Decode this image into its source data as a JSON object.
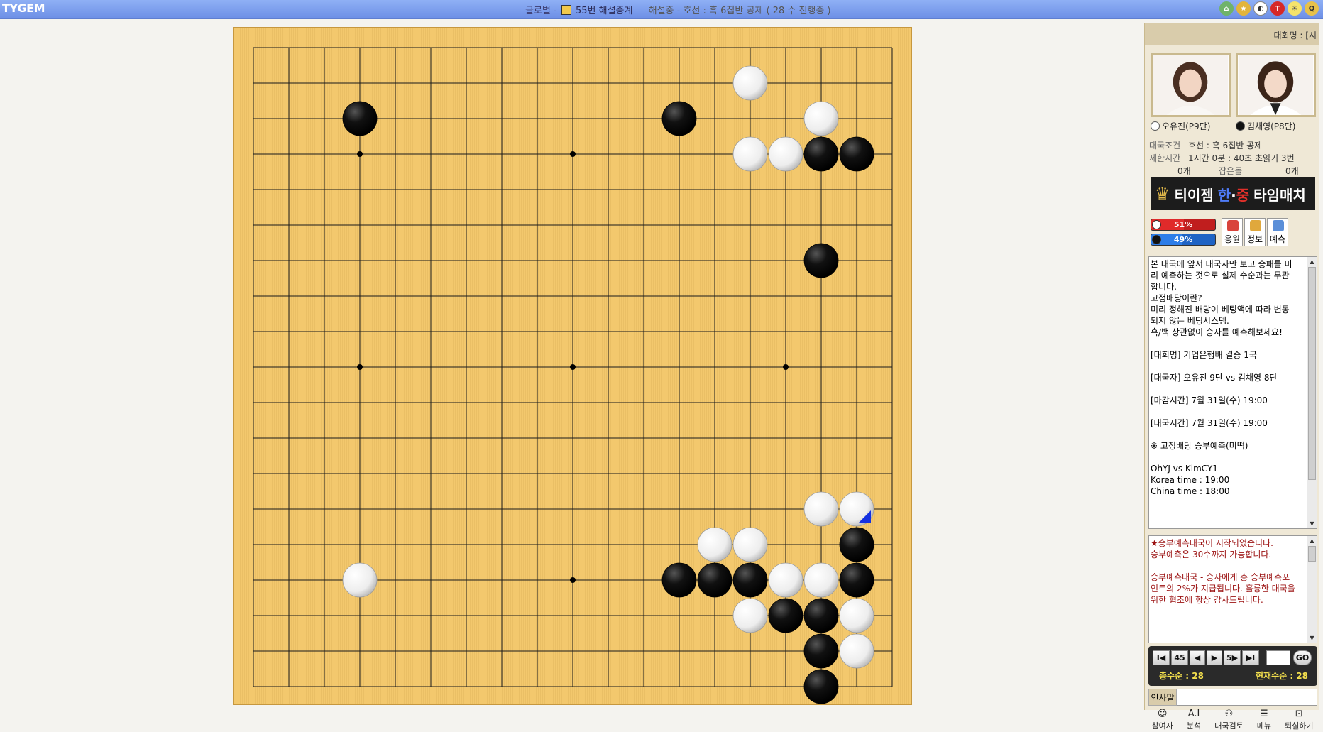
{
  "app": {
    "logo": "TYGEM"
  },
  "titlebar": {
    "prefix": "글로벌 -",
    "room": "55번 해설중계",
    "status": "해설중 - 호선 : 흑 6집반 공제 ( 28 수 진행중 )"
  },
  "top_icons": [
    "home-icon",
    "rank-icon",
    "penguin-icon",
    "t-icon",
    "bulb-icon",
    "quiz-icon"
  ],
  "board": {
    "size": 19,
    "hoshi": [
      [
        3,
        3
      ],
      [
        9,
        3
      ],
      [
        15,
        3
      ],
      [
        3,
        9
      ],
      [
        9,
        9
      ],
      [
        15,
        9
      ],
      [
        3,
        15
      ],
      [
        9,
        15
      ],
      [
        15,
        15
      ]
    ],
    "stones": [
      {
        "c": "w",
        "x": 14,
        "y": 1
      },
      {
        "c": "b",
        "x": 3,
        "y": 2
      },
      {
        "c": "b",
        "x": 12,
        "y": 2
      },
      {
        "c": "w",
        "x": 16,
        "y": 2
      },
      {
        "c": "w",
        "x": 14,
        "y": 3
      },
      {
        "c": "w",
        "x": 15,
        "y": 3
      },
      {
        "c": "b",
        "x": 16,
        "y": 3
      },
      {
        "c": "b",
        "x": 17,
        "y": 3
      },
      {
        "c": "b",
        "x": 16,
        "y": 6
      },
      {
        "c": "w",
        "x": 16,
        "y": 13
      },
      {
        "c": "w",
        "x": 17,
        "y": 13,
        "last": true
      },
      {
        "c": "w",
        "x": 13,
        "y": 14
      },
      {
        "c": "w",
        "x": 14,
        "y": 14
      },
      {
        "c": "b",
        "x": 17,
        "y": 14
      },
      {
        "c": "w",
        "x": 3,
        "y": 15
      },
      {
        "c": "b",
        "x": 12,
        "y": 15
      },
      {
        "c": "b",
        "x": 13,
        "y": 15
      },
      {
        "c": "b",
        "x": 14,
        "y": 15
      },
      {
        "c": "w",
        "x": 15,
        "y": 15
      },
      {
        "c": "w",
        "x": 16,
        "y": 15
      },
      {
        "c": "b",
        "x": 17,
        "y": 15
      },
      {
        "c": "w",
        "x": 14,
        "y": 16
      },
      {
        "c": "b",
        "x": 15,
        "y": 16
      },
      {
        "c": "b",
        "x": 16,
        "y": 16
      },
      {
        "c": "w",
        "x": 17,
        "y": 16
      },
      {
        "c": "b",
        "x": 16,
        "y": 17
      },
      {
        "c": "w",
        "x": 17,
        "y": 17
      },
      {
        "c": "b",
        "x": 16,
        "y": 18
      }
    ]
  },
  "panel": {
    "header": "대회명 : [시",
    "white_player": "오유진(P9단)",
    "black_player": "김채영(P8단)",
    "cond_label": "대국조건",
    "cond_value": "호선 : 흑 6집반 공제",
    "time_label": "제한시간",
    "time_value": "1시간 0분 : 40초 초읽기 3번",
    "captured_label": "잡은돌",
    "captured_white": "0개",
    "captured_black": "0개",
    "banner_pre": "티이젬",
    "banner_han": "한",
    "banner_dot": "·",
    "banner_jung": "중",
    "banner_post": "타임매치",
    "white_pct": "51%",
    "black_pct": "49%",
    "white_pct_value": 51,
    "black_pct_value": 49,
    "btn_cheer": "응원",
    "btn_info": "정보",
    "btn_predict": "예측",
    "info_lines": [
      "본 대국에 앞서 대국자만 보고 승패를 미",
      "리 예측하는 것으로 실제 수순과는 무관",
      "합니다.",
      "고정배당이란?",
      "미리 정해진 배당이 베팅액에 따라 변동",
      "되지 않는 베팅시스템.",
      "흑/백 상관없이 승자를 예측해보세요!",
      "",
      "[대회명] 기업은행배 결승 1국",
      "",
      "[대국자] 오유진 9단 vs 김채영 8단",
      "",
      "[마감시간] 7월 31일(수) 19:00",
      "",
      "[대국시간] 7월 31일(수) 19:00",
      "",
      "※ 고정배당 승부예측(미떡)",
      "",
      "OhYJ vs KimCY1",
      "Korea time : 19:00",
      "China time : 18:00"
    ],
    "notice_lines": [
      "★승부예측대국이 시작되었습니다.",
      "승부예측은 30수까지 가능합니다.",
      "",
      "승부예측대국 - 승자에게 총 승부예측포",
      "인트의 2%가 지급됩니다. 훌륭한 대국을",
      "위한 협조에 항상 감사드립니다."
    ],
    "nav": {
      "first": "I◀",
      "back5": "45",
      "prev": "◀",
      "next": "▶",
      "fwd5": "5▶",
      "last": "▶I",
      "go": "GO",
      "total_label": "총수순 : 28",
      "current_label": "현재수순 : 28"
    },
    "chat_label": "인사말",
    "chat_value": "",
    "toolbar": [
      {
        "label": "참여자",
        "icon": "people-icon",
        "glyph": "☺"
      },
      {
        "label": "분석",
        "icon": "ai-icon",
        "glyph": "A.I"
      },
      {
        "label": "대국검토",
        "icon": "review-icon",
        "glyph": "⚇"
      },
      {
        "label": "메뉴",
        "icon": "book-icon",
        "glyph": "☰"
      },
      {
        "label": "퇴실하기",
        "icon": "exit-icon",
        "glyph": "⊡"
      }
    ]
  }
}
